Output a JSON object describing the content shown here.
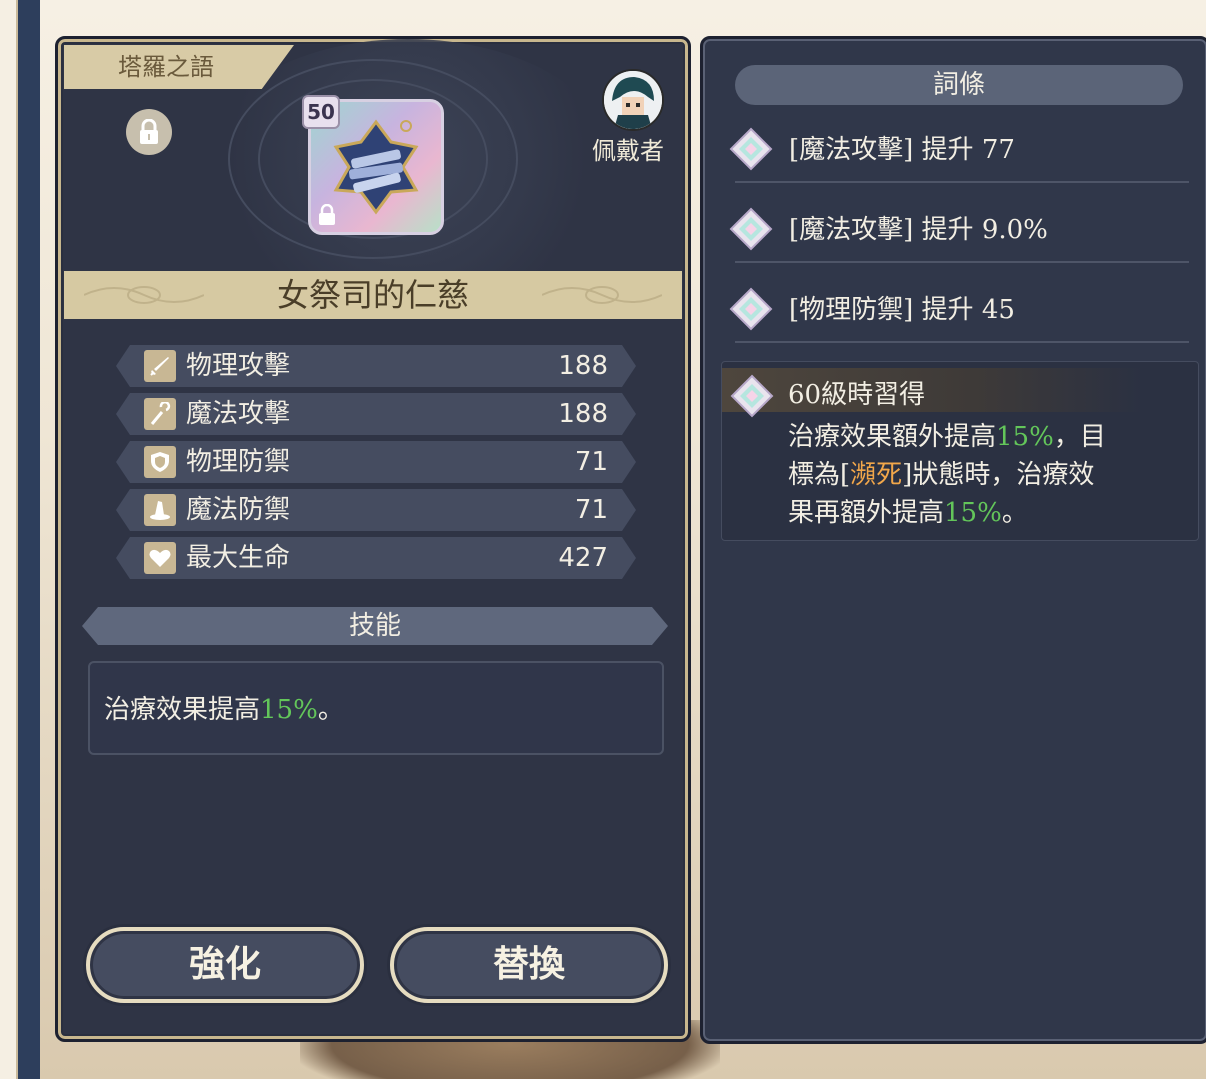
{
  "equipment": {
    "category": "塔羅之語",
    "level": "50",
    "wearer_label": "佩戴者",
    "name": "女祭司的仁慈"
  },
  "stats": [
    {
      "label": "物理攻擊",
      "value": "188",
      "icon": "sword-icon"
    },
    {
      "label": "魔法攻擊",
      "value": "188",
      "icon": "staff-icon"
    },
    {
      "label": "物理防禦",
      "value": "71",
      "icon": "shield-icon"
    },
    {
      "label": "魔法防禦",
      "value": "71",
      "icon": "wizard-hat-icon"
    },
    {
      "label": "最大生命",
      "value": "427",
      "icon": "heart-icon"
    }
  ],
  "skill": {
    "header": "技能",
    "desc_prefix": "治療效果提高",
    "desc_value": "15%",
    "desc_suffix": "。"
  },
  "buttons": {
    "enhance": "強化",
    "replace": "替換"
  },
  "entries": {
    "header": "詞條",
    "items": [
      {
        "text": "[魔法攻擊] 提升 77"
      },
      {
        "text": "[魔法攻擊] 提升 9.0%"
      },
      {
        "text": "[物理防禦] 提升 45"
      }
    ],
    "unlock": {
      "title": "60級時習得",
      "line1_a": "治療效果額外提高",
      "line1_b": "15%",
      "line1_c": "，目",
      "line2_a": "標為[",
      "line2_b": "瀕死",
      "line2_c": "]狀態時，治療效",
      "line3_a": "果再額外提高",
      "line3_b": "15%",
      "line3_c": "。"
    }
  },
  "colors": {
    "highlight_green": "#63c65a",
    "highlight_orange": "#f2a74a",
    "panel_bg": "#2f3445",
    "gold": "#d6c9a2"
  }
}
